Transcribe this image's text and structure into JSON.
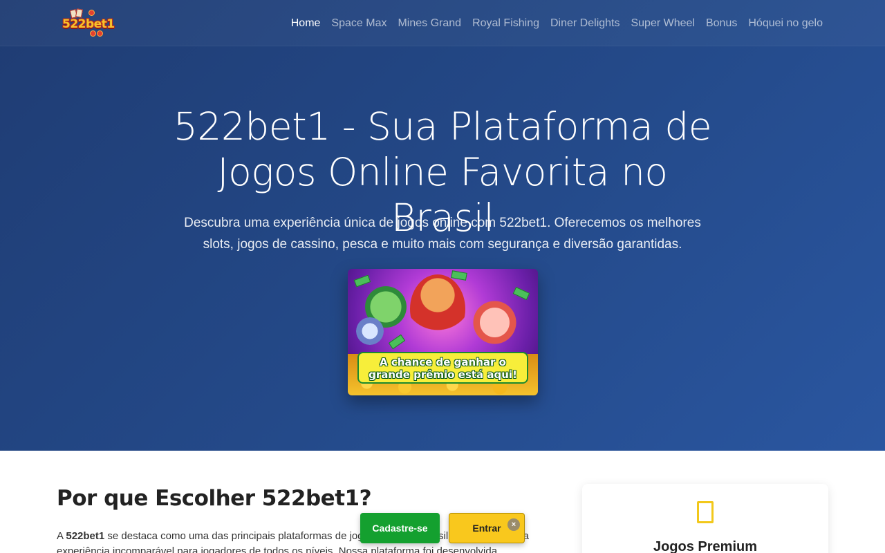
{
  "brand": {
    "logo_text": "522bet1"
  },
  "nav": {
    "items": [
      {
        "label": "Home",
        "active": true
      },
      {
        "label": "Space Max",
        "active": false
      },
      {
        "label": "Mines Grand",
        "active": false
      },
      {
        "label": "Royal Fishing",
        "active": false
      },
      {
        "label": "Diner Delights",
        "active": false
      },
      {
        "label": "Super Wheel",
        "active": false
      },
      {
        "label": "Bonus",
        "active": false
      },
      {
        "label": "Hóquei no gelo",
        "active": false
      }
    ]
  },
  "hero": {
    "title": "522bet1 - Sua Plataforma de Jogos Online Favorita no Brasil",
    "subtitle": "Descubra uma experiência única de jogos online com 522bet1. Oferecemos os melhores slots, jogos de cassino, pesca e muito mais com segurança e diversão garantidas.",
    "image_banner_line1": "A chance de ganhar o",
    "image_banner_line2": "grande prêmio está aqui!"
  },
  "about": {
    "heading": "Por que Escolher 522bet1?",
    "intro_prefix": "A ",
    "intro_brand": "522bet1",
    "intro_rest": " se destaca como uma das principais plataformas de jogos online do Brasil, oferecendo uma experiência incomparável para jogadores de todos os níveis. Nossa plataforma foi desenvolvida"
  },
  "feature": {
    "title": "Jogos Premium",
    "icon": "mobile-icon"
  },
  "cta": {
    "register_label": "Cadastre-se",
    "login_label": "Entrar",
    "close_label": "×"
  },
  "colors": {
    "hero_bg": "#244a8a",
    "register": "#14a02f",
    "login": "#f9c81d",
    "accent_icon": "#f2c81b"
  }
}
